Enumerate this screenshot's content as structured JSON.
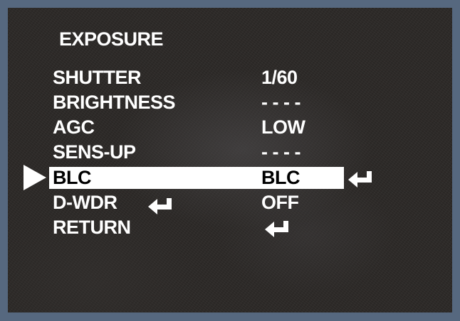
{
  "menu": {
    "title": "EXPOSURE",
    "items": [
      {
        "label": "SHUTTER",
        "value": "1/60"
      },
      {
        "label": "BRIGHTNESS",
        "value": "- - - -"
      },
      {
        "label": "AGC",
        "value": "LOW"
      },
      {
        "label": "SENS-UP",
        "value": "- - - -"
      },
      {
        "label": "BLC",
        "value": "BLC",
        "selected": true,
        "icon": "enter-icon"
      },
      {
        "label": "D-WDR",
        "value": "OFF",
        "icon": "enter-icon"
      },
      {
        "label": "RETURN",
        "icon": "enter-icon"
      }
    ]
  },
  "colors": {
    "frame": "#56687f",
    "screen": "#2b2826",
    "text": "#ffffff",
    "highlight": "#ffffff",
    "highlight_text": "#000000"
  },
  "icons": {
    "pointer": "right-triangle-pointer-icon",
    "enter": "enter-return-arrow-icon"
  }
}
